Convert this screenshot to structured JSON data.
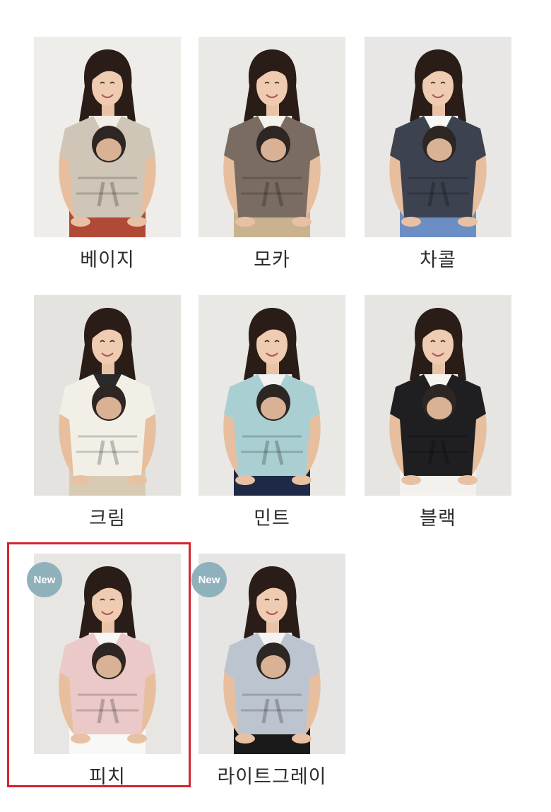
{
  "products": [
    {
      "label": "베이지",
      "badge": null,
      "wrap_color": "#cfc6b8",
      "wall_color": "#efedea",
      "bottom_color": "#b04a36",
      "inner_color": "#f2eee6"
    },
    {
      "label": "모카",
      "badge": null,
      "wrap_color": "#7a6c62",
      "wall_color": "#ebe9e6",
      "bottom_color": "#c9b38e",
      "inner_color": "#f4f1ea"
    },
    {
      "label": "차콜",
      "badge": null,
      "wrap_color": "#3d4250",
      "wall_color": "#e8e7e5",
      "bottom_color": "#6c8ec4",
      "inner_color": "#f7f7f5"
    },
    {
      "label": "크림",
      "badge": null,
      "wrap_color": "#f2efe6",
      "wall_color": "#e4e3df",
      "bottom_color": "#d8cbb4",
      "inner_color": "#2a2a2a"
    },
    {
      "label": "민트",
      "badge": null,
      "wrap_color": "#a9cfd2",
      "wall_color": "#e9e8e5",
      "bottom_color": "#1e2a45",
      "inner_color": "#f2f2f0"
    },
    {
      "label": "블랙",
      "badge": null,
      "wrap_color": "#1f1f22",
      "wall_color": "#e6e5e2",
      "bottom_color": "#f2f1ee",
      "inner_color": "#f5f4f1"
    },
    {
      "label": "피치",
      "badge": "New",
      "wrap_color": "#ecc9c9",
      "wall_color": "#e7e6e3",
      "bottom_color": "#f8f8f6",
      "inner_color": "#f8f7f5"
    },
    {
      "label": "라이트그레이",
      "badge": "New",
      "wrap_color": "#bcc5cf",
      "wall_color": "#e6e5e3",
      "bottom_color": "#1a1a1a",
      "inner_color": "#f4f4f2"
    }
  ],
  "selected_index": 6,
  "colors": {
    "badge": "#8fb1bb",
    "selection_border": "#d4252f",
    "label_text": "#2b2b2b"
  }
}
